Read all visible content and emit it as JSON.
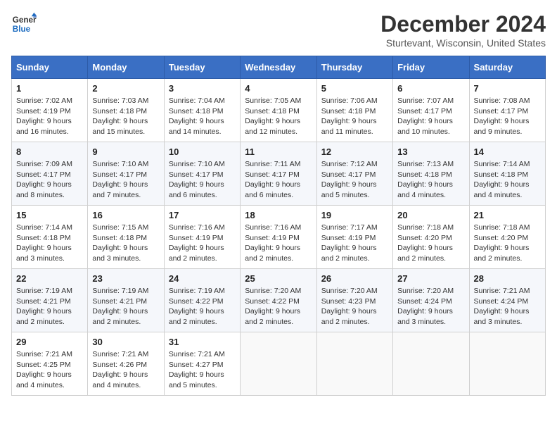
{
  "header": {
    "logo_line1": "General",
    "logo_line2": "Blue",
    "month_title": "December 2024",
    "location": "Sturtevant, Wisconsin, United States"
  },
  "weekdays": [
    "Sunday",
    "Monday",
    "Tuesday",
    "Wednesday",
    "Thursday",
    "Friday",
    "Saturday"
  ],
  "weeks": [
    [
      {
        "day": "1",
        "sunrise": "7:02 AM",
        "sunset": "4:19 PM",
        "daylight": "9 hours and 16 minutes."
      },
      {
        "day": "2",
        "sunrise": "7:03 AM",
        "sunset": "4:18 PM",
        "daylight": "9 hours and 15 minutes."
      },
      {
        "day": "3",
        "sunrise": "7:04 AM",
        "sunset": "4:18 PM",
        "daylight": "9 hours and 14 minutes."
      },
      {
        "day": "4",
        "sunrise": "7:05 AM",
        "sunset": "4:18 PM",
        "daylight": "9 hours and 12 minutes."
      },
      {
        "day": "5",
        "sunrise": "7:06 AM",
        "sunset": "4:18 PM",
        "daylight": "9 hours and 11 minutes."
      },
      {
        "day": "6",
        "sunrise": "7:07 AM",
        "sunset": "4:17 PM",
        "daylight": "9 hours and 10 minutes."
      },
      {
        "day": "7",
        "sunrise": "7:08 AM",
        "sunset": "4:17 PM",
        "daylight": "9 hours and 9 minutes."
      }
    ],
    [
      {
        "day": "8",
        "sunrise": "7:09 AM",
        "sunset": "4:17 PM",
        "daylight": "9 hours and 8 minutes."
      },
      {
        "day": "9",
        "sunrise": "7:10 AM",
        "sunset": "4:17 PM",
        "daylight": "9 hours and 7 minutes."
      },
      {
        "day": "10",
        "sunrise": "7:10 AM",
        "sunset": "4:17 PM",
        "daylight": "9 hours and 6 minutes."
      },
      {
        "day": "11",
        "sunrise": "7:11 AM",
        "sunset": "4:17 PM",
        "daylight": "9 hours and 6 minutes."
      },
      {
        "day": "12",
        "sunrise": "7:12 AM",
        "sunset": "4:17 PM",
        "daylight": "9 hours and 5 minutes."
      },
      {
        "day": "13",
        "sunrise": "7:13 AM",
        "sunset": "4:18 PM",
        "daylight": "9 hours and 4 minutes."
      },
      {
        "day": "14",
        "sunrise": "7:14 AM",
        "sunset": "4:18 PM",
        "daylight": "9 hours and 4 minutes."
      }
    ],
    [
      {
        "day": "15",
        "sunrise": "7:14 AM",
        "sunset": "4:18 PM",
        "daylight": "9 hours and 3 minutes."
      },
      {
        "day": "16",
        "sunrise": "7:15 AM",
        "sunset": "4:18 PM",
        "daylight": "9 hours and 3 minutes."
      },
      {
        "day": "17",
        "sunrise": "7:16 AM",
        "sunset": "4:19 PM",
        "daylight": "9 hours and 2 minutes."
      },
      {
        "day": "18",
        "sunrise": "7:16 AM",
        "sunset": "4:19 PM",
        "daylight": "9 hours and 2 minutes."
      },
      {
        "day": "19",
        "sunrise": "7:17 AM",
        "sunset": "4:19 PM",
        "daylight": "9 hours and 2 minutes."
      },
      {
        "day": "20",
        "sunrise": "7:18 AM",
        "sunset": "4:20 PM",
        "daylight": "9 hours and 2 minutes."
      },
      {
        "day": "21",
        "sunrise": "7:18 AM",
        "sunset": "4:20 PM",
        "daylight": "9 hours and 2 minutes."
      }
    ],
    [
      {
        "day": "22",
        "sunrise": "7:19 AM",
        "sunset": "4:21 PM",
        "daylight": "9 hours and 2 minutes."
      },
      {
        "day": "23",
        "sunrise": "7:19 AM",
        "sunset": "4:21 PM",
        "daylight": "9 hours and 2 minutes."
      },
      {
        "day": "24",
        "sunrise": "7:19 AM",
        "sunset": "4:22 PM",
        "daylight": "9 hours and 2 minutes."
      },
      {
        "day": "25",
        "sunrise": "7:20 AM",
        "sunset": "4:22 PM",
        "daylight": "9 hours and 2 minutes."
      },
      {
        "day": "26",
        "sunrise": "7:20 AM",
        "sunset": "4:23 PM",
        "daylight": "9 hours and 2 minutes."
      },
      {
        "day": "27",
        "sunrise": "7:20 AM",
        "sunset": "4:24 PM",
        "daylight": "9 hours and 3 minutes."
      },
      {
        "day": "28",
        "sunrise": "7:21 AM",
        "sunset": "4:24 PM",
        "daylight": "9 hours and 3 minutes."
      }
    ],
    [
      {
        "day": "29",
        "sunrise": "7:21 AM",
        "sunset": "4:25 PM",
        "daylight": "9 hours and 4 minutes."
      },
      {
        "day": "30",
        "sunrise": "7:21 AM",
        "sunset": "4:26 PM",
        "daylight": "9 hours and 4 minutes."
      },
      {
        "day": "31",
        "sunrise": "7:21 AM",
        "sunset": "4:27 PM",
        "daylight": "9 hours and 5 minutes."
      },
      null,
      null,
      null,
      null
    ]
  ],
  "labels": {
    "sunrise": "Sunrise:",
    "sunset": "Sunset:",
    "daylight": "Daylight:"
  }
}
